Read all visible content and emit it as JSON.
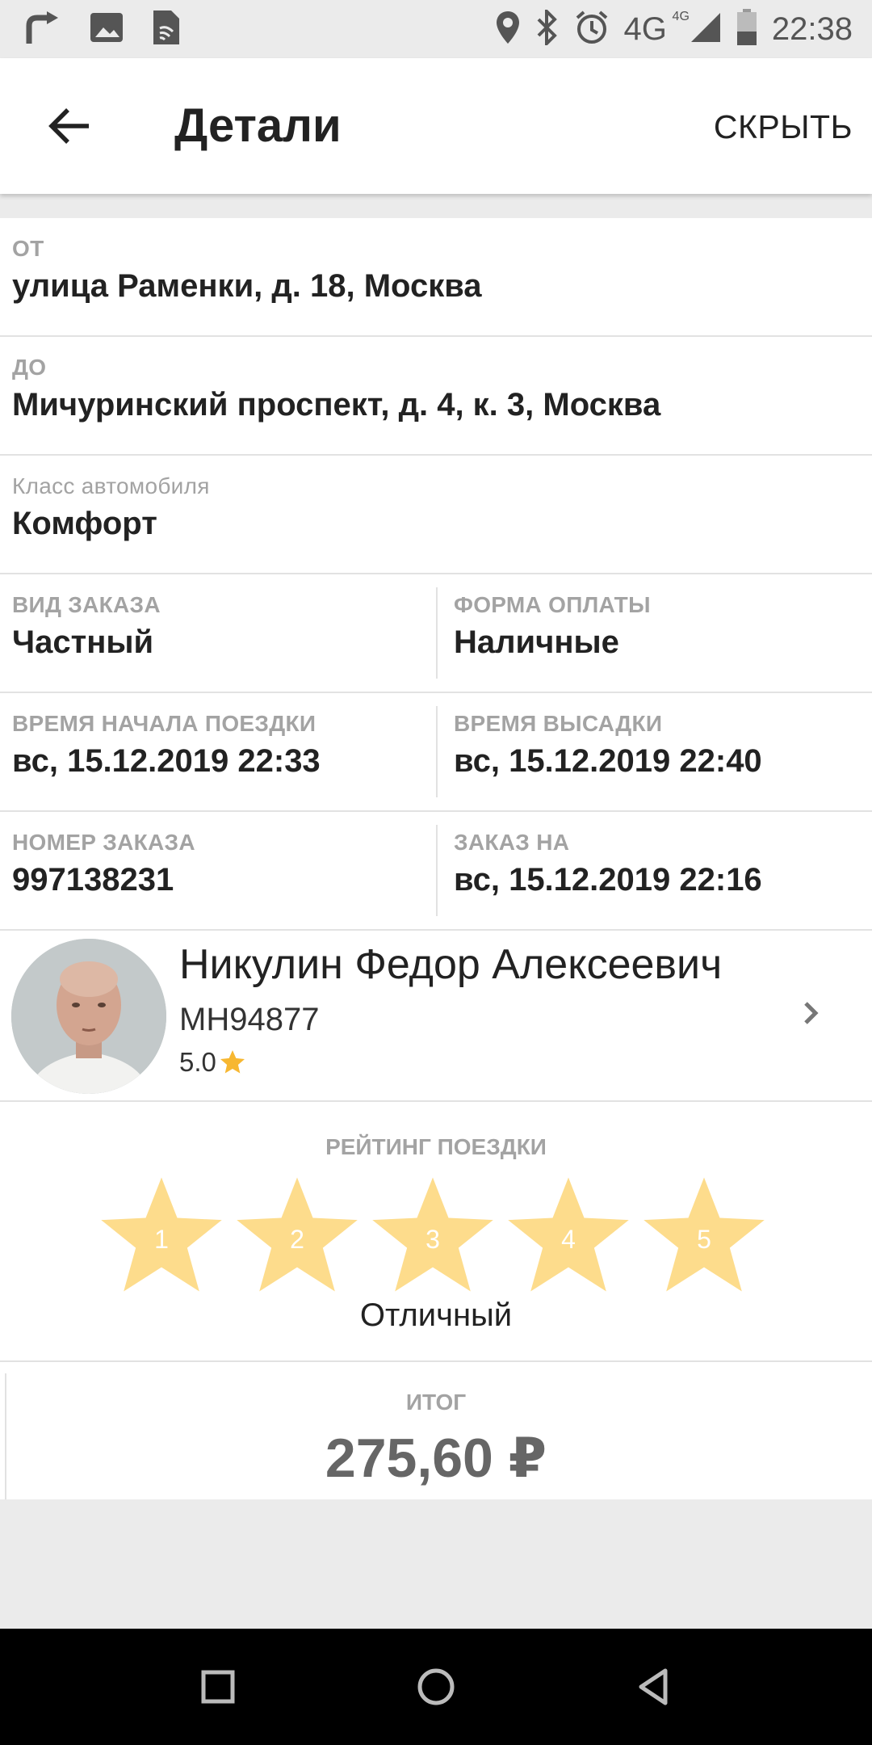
{
  "status_bar": {
    "time": "22:38",
    "network": "4G",
    "network_sup": "4G",
    "icons_left": [
      "forward-icon",
      "image-icon",
      "sim-icon"
    ],
    "icons_right": [
      "location-icon",
      "bluetooth-icon",
      "alarm-icon",
      "signal-icon",
      "battery-icon"
    ]
  },
  "appbar": {
    "title": "Детали",
    "hide_label": "СКРЫТЬ"
  },
  "details": {
    "from": {
      "label": "ОТ",
      "value": "улица Раменки, д. 18, Москва"
    },
    "to": {
      "label": "ДО",
      "value": "Мичуринский проспект, д. 4, к. 3, Москва"
    },
    "car_class": {
      "label": "Класс автомобиля",
      "value": "Комфорт"
    },
    "order_type": {
      "label": "ВИД ЗАКАЗА",
      "value": "Частный"
    },
    "payment": {
      "label": "ФОРМА ОПЛАТЫ",
      "value": "Наличные"
    },
    "start_time": {
      "label": "ВРЕМЯ НАЧАЛА ПОЕЗДКИ",
      "value": "вс, 15.12.2019 22:33"
    },
    "dropoff_time": {
      "label": "ВРЕМЯ ВЫСАДКИ",
      "value": "вс, 15.12.2019 22:40"
    },
    "order_number": {
      "label": "НОМЕР ЗАКАЗА",
      "value": "997138231"
    },
    "order_for": {
      "label": "ЗАКАЗ НА",
      "value": "вс, 15.12.2019 22:16"
    }
  },
  "driver": {
    "name": "Никулин Федор Алексеевич",
    "plate": "МН94877",
    "rating": "5.0"
  },
  "trip_rating": {
    "label": "РЕЙТИНГ ПОЕЗДКИ",
    "stars": [
      "1",
      "2",
      "3",
      "4",
      "5"
    ],
    "text": "Отличный",
    "star_color": "#fddc8c"
  },
  "total": {
    "label": "ИТОГ",
    "value": "275,60 ₽"
  }
}
